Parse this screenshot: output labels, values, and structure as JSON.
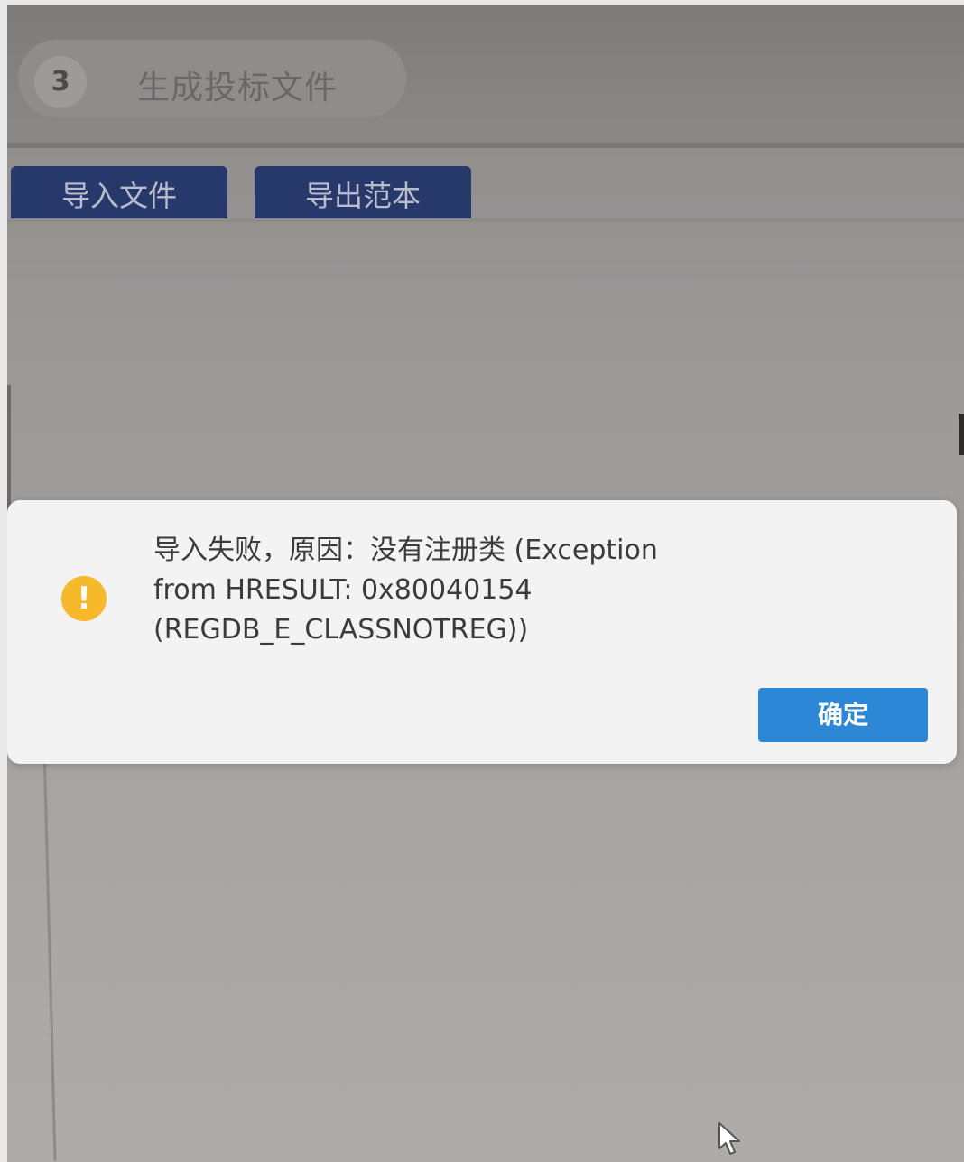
{
  "step": {
    "number": "3",
    "label": "生成投标文件"
  },
  "toolbar": {
    "import_label": "导入文件",
    "export_label": "导出范本"
  },
  "dialog": {
    "icon": "warning-icon",
    "message_lines": [
      "导入失败，原因：没有注册类 (Exception",
      "from HRESULT: 0x80040154",
      "(REGDB_E_CLASSNOTREG))"
    ],
    "confirm_label": "确定"
  },
  "colors": {
    "toolbar_button": "#27386a",
    "confirm_button": "#2c87d6",
    "warning": "#f5b92a"
  }
}
